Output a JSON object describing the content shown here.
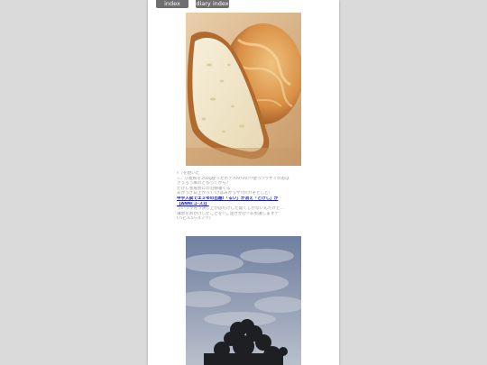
{
  "nav": {
    "index_label": "index",
    "diary_label": "diary index"
  },
  "entry": {
    "lines_top": [
      "ﾊﾟﾝを焼いた",
      "☆、小麦粉を250g使ったホテ?09?00!!?使っ!!ラサイのおば",
      "きうろう風のと作ってから?",
      "たけし会場会にの沿静書くる",
      "あかうぎ日上がって!けはみかうサ!かけ!ぞとしと!"
    ],
    "link_text": "中学入試でエミゆの出題!「るい」が消え「とけし」が",
    "link_more": "【ANN(コ-ス)】",
    "lines_bottom": [
      "ういうが先う決し上かはだけした開くしかないんだけど…",
      "講習をおかけしたことを!!ご足せかけ!!あ歩講しますテ",
      "(バビル5ら)(プリ)"
    ]
  }
}
